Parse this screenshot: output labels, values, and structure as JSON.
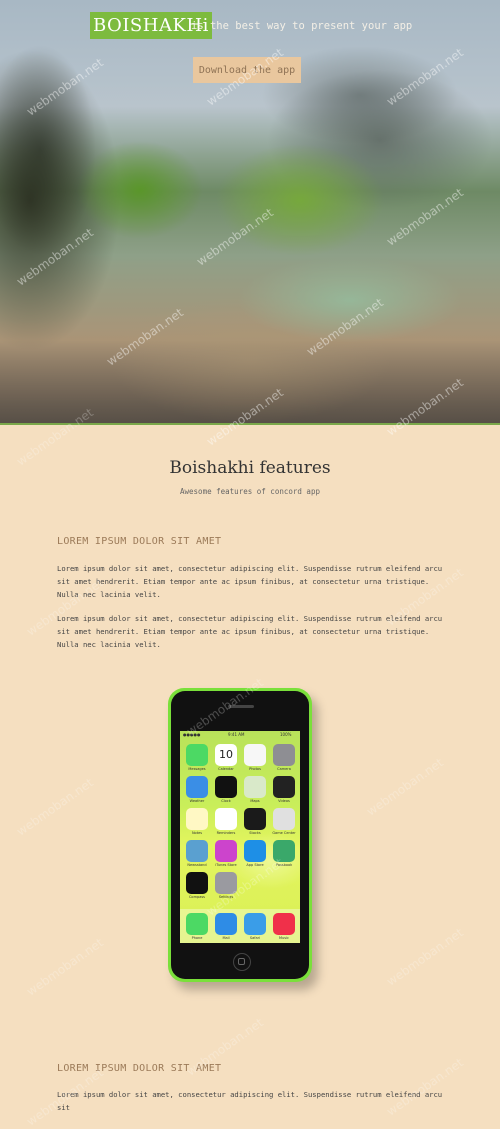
{
  "header": {
    "brand": "BOISHAKHi",
    "tagline": "is the best way to present your app",
    "download_label": "Download the app"
  },
  "features": {
    "title": "Boishakhi features",
    "subtitle": "Awesome features of concord app"
  },
  "sections": [
    {
      "heading": "LOREM IPSUM DOLOR SIT AMET",
      "paragraphs": [
        "Lorem ipsum dolor sit amet, consectetur adipiscing elit. Suspendisse rutrum eleifend arcu sit amet hendrerit. Etiam tempor ante ac ipsum finibus, at consectetur urna tristique. Nulla nec lacinia velit.",
        "Lorem ipsum dolor sit amet, consectetur adipiscing elit. Suspendisse rutrum eleifend arcu sit amet hendrerit. Etiam tempor ante ac ipsum finibus, at consectetur urna tristique. Nulla nec lacinia velit."
      ]
    },
    {
      "heading": "LOREM IPSUM DOLOR SIT AMET",
      "paragraphs": [
        "Lorem ipsum dolor sit amet, consectetur adipiscing elit. Suspendisse rutrum eleifend arcu sit"
      ]
    }
  ],
  "phone": {
    "status_carrier": "●●●●● ",
    "status_time": "9:41 AM",
    "status_battery": "100%",
    "apps": [
      {
        "label": "Messages",
        "color": "#4cd964",
        "icon": "messages-icon"
      },
      {
        "label": "Calendar",
        "color": "#ffffff",
        "icon": "calendar-icon",
        "glyph": "10"
      },
      {
        "label": "Photos",
        "color": "#f7f7f7",
        "icon": "photos-icon"
      },
      {
        "label": "Camera",
        "color": "#8e8e93",
        "icon": "camera-icon"
      },
      {
        "label": "Weather",
        "color": "#3a8ee6",
        "icon": "weather-icon"
      },
      {
        "label": "Clock",
        "color": "#111111",
        "icon": "clock-icon"
      },
      {
        "label": "Maps",
        "color": "#d9e9c9",
        "icon": "maps-icon"
      },
      {
        "label": "Videos",
        "color": "#222222",
        "icon": "videos-icon"
      },
      {
        "label": "Notes",
        "color": "#fff8c4",
        "icon": "notes-icon"
      },
      {
        "label": "Reminders",
        "color": "#ffffff",
        "icon": "reminders-icon"
      },
      {
        "label": "Stocks",
        "color": "#1a1a1a",
        "icon": "stocks-icon"
      },
      {
        "label": "Game Center",
        "color": "#e0e0e0",
        "icon": "game-center-icon"
      },
      {
        "label": "Newsstand",
        "color": "#5aa0d0",
        "icon": "newsstand-icon"
      },
      {
        "label": "iTunes Store",
        "color": "#cc44cc",
        "icon": "itunes-store-icon"
      },
      {
        "label": "App Store",
        "color": "#1e8fe6",
        "icon": "app-store-icon"
      },
      {
        "label": "Passbook",
        "color": "#3aa86a",
        "icon": "passbook-icon"
      },
      {
        "label": "Compass",
        "color": "#111111",
        "icon": "compass-icon"
      },
      {
        "label": "Settings",
        "color": "#9a9aa0",
        "icon": "settings-icon"
      }
    ],
    "dock": [
      {
        "label": "Phone",
        "color": "#4cd964",
        "icon": "phone-icon"
      },
      {
        "label": "Mail",
        "color": "#2e8ce6",
        "icon": "mail-icon"
      },
      {
        "label": "Safari",
        "color": "#3a9de8",
        "icon": "safari-icon"
      },
      {
        "label": "Music",
        "color": "#f0304a",
        "icon": "music-icon"
      }
    ]
  },
  "watermark": "webmoban.net",
  "colors": {
    "brand_bg": "#7dbb3e",
    "page_bg": "#f5dfc0",
    "button_bg": "#e9c79e",
    "phone_body": "#7ae03a",
    "heading": "#9b7a58"
  }
}
